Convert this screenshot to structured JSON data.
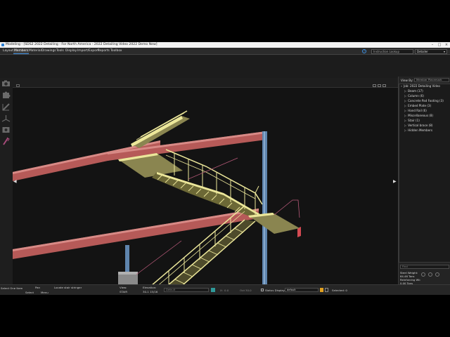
{
  "window": {
    "title": "Modeling - [SDS2 2022 Detailing - For North America - 2022 Detailing Video 2022 Demo New]"
  },
  "menu": {
    "items": [
      "Layout",
      "Members",
      "Material",
      "Drawings",
      "Tools",
      "Display",
      "Import/Export",
      "Reports",
      "Toolbox"
    ],
    "active_index": 1
  },
  "toolbar_right": {
    "help_icon": "help-circle-icon",
    "search_placeholder": "Instruction Lookup",
    "role_value": "Detailer"
  },
  "right_panel": {
    "view_by_label": "View By:",
    "view_by_value": "Member Piecemark",
    "root": "Job: 2022 Detailing Video",
    "items": [
      "Beam (17)",
      "Column (6)",
      "Concrete Pad Footing (3)",
      "Embed Plate (3)",
      "Hand Rail (6)",
      "Miscellaneous (8)",
      "Stair (1)",
      "Vertical brace (8)",
      "Hidden Members"
    ],
    "find_label": "Find",
    "steel_weight_label": "Steel Weight:",
    "steel_weight_value": "64.46 Tons",
    "reinforcing_label": "Reinforcing Wt:",
    "reinforcing_value": "0.00 Tons"
  },
  "status_bar": {
    "select_one_item": "Select One Item",
    "pan": "Pan",
    "locate": "Locate stair stringer",
    "select": "Select",
    "menu": "Menu",
    "view_label": "View:",
    "view_value": "STAIR",
    "elevation_label": "Elevation:",
    "elevation_value": "30-1 15/16",
    "default_field": "Default",
    "x_label": "X:",
    "x_value": "0.0",
    "out_label": "Out",
    "out_value": "30.0",
    "status_display": "Status Display",
    "status_value": "default",
    "selected": "Selected: 0"
  },
  "colors": {
    "beam": "#b65a58",
    "beam_dark": "#7a3534",
    "column": "#5e84ad",
    "stair": "#ece79a",
    "stair_dark": "#8a8550",
    "footing": "#8a8a8a",
    "accent": "#3d8fe0"
  }
}
